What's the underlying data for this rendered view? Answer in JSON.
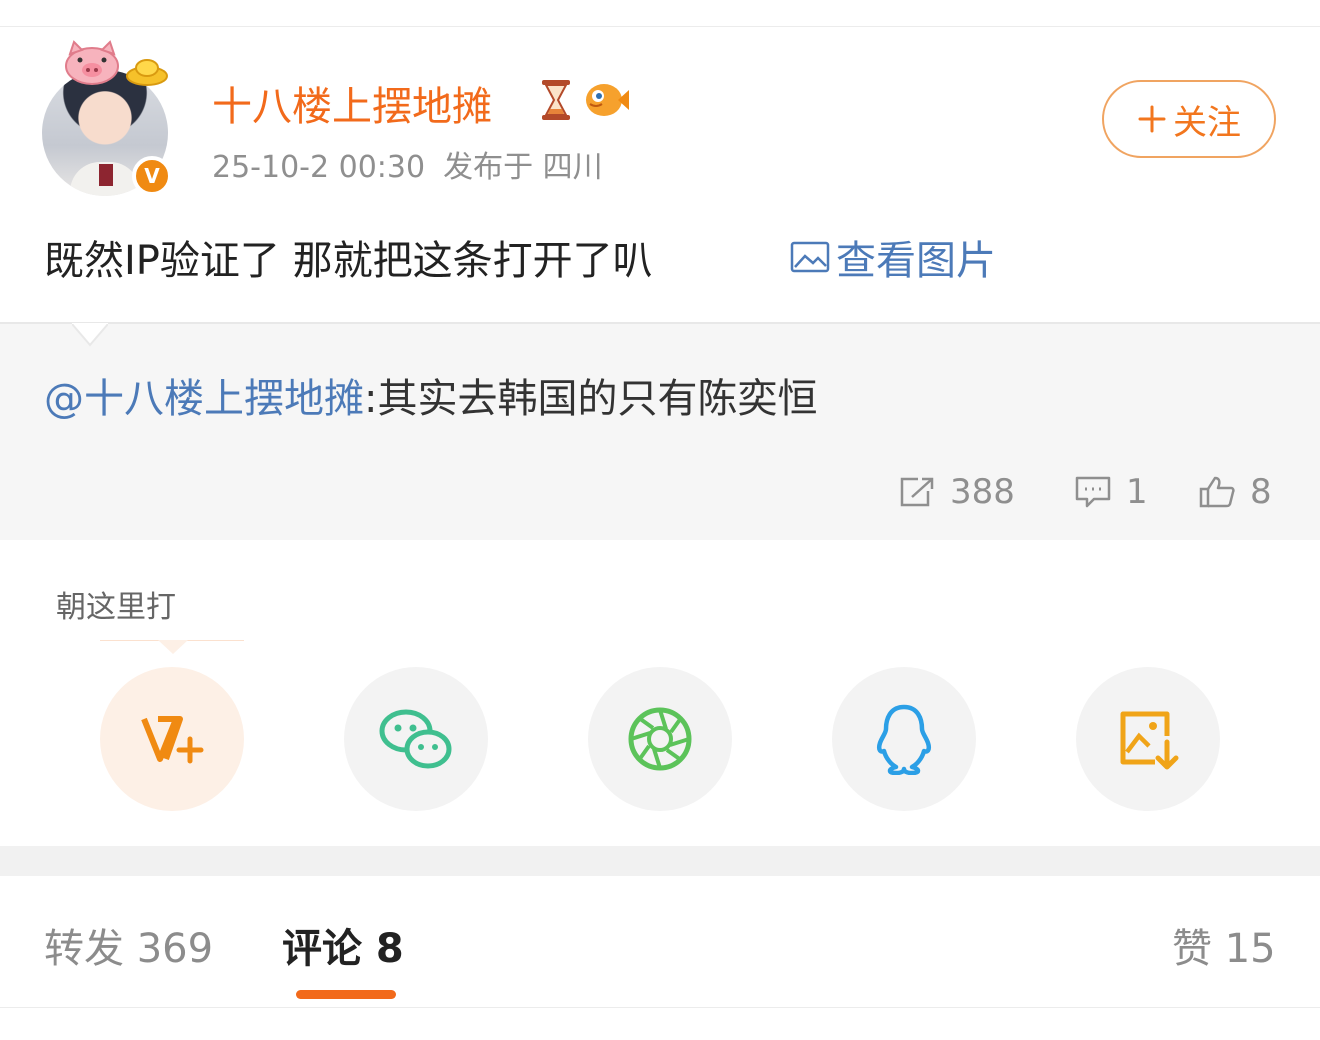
{
  "post": {
    "username": "十八楼上摆地摊",
    "timestamp": "25-10-2 00:30",
    "location": "发布于 四川",
    "follow_label": "关注",
    "text": "既然IP验证了 那就把这条打开了叭",
    "view_image_label": "查看图片",
    "verified_mark": "V"
  },
  "repost": {
    "mention": "@十八楼上摆地摊",
    "text": ":其实去韩国的只有陈奕恒",
    "reposts": "388",
    "comments": "1",
    "likes": "8"
  },
  "share": {
    "label": "朝这里打",
    "targets": [
      {
        "icon": "weibo-v-plus-icon"
      },
      {
        "icon": "wechat-icon"
      },
      {
        "icon": "moments-icon"
      },
      {
        "icon": "qq-icon"
      },
      {
        "icon": "save-image-icon"
      }
    ]
  },
  "tabs": {
    "repost": "转发 369",
    "comments": "评论 8",
    "likes": "赞 15"
  },
  "colors": {
    "accent": "#f26a1b",
    "link": "#4c7ab8",
    "muted": "#8f8f8f"
  }
}
